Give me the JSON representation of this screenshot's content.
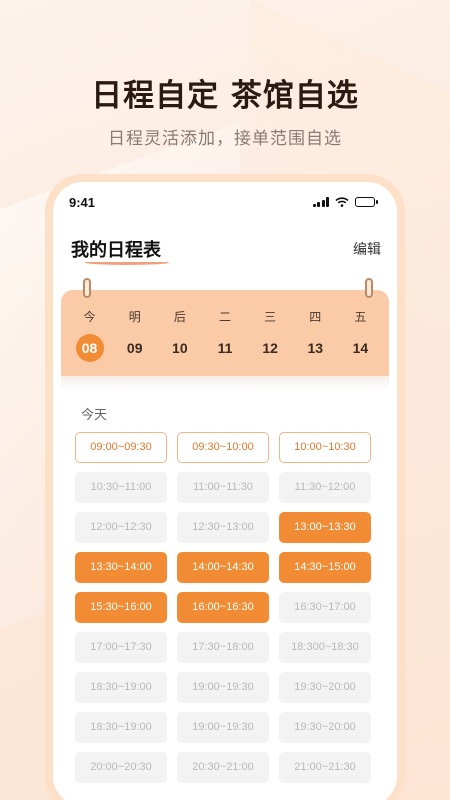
{
  "promo": {
    "headline": "日程自定  茶馆自选",
    "subline": "日程灵活添加，接单范围自选"
  },
  "status_bar": {
    "time": "9:41",
    "icons": [
      "signal-icon",
      "wifi-icon",
      "battery-icon"
    ]
  },
  "header": {
    "title": "我的日程表",
    "edit_label": "编辑"
  },
  "calendar": {
    "days": [
      {
        "weekday": "今",
        "date": "08",
        "active": true
      },
      {
        "weekday": "明",
        "date": "09",
        "active": false
      },
      {
        "weekday": "后",
        "date": "10",
        "active": false
      },
      {
        "weekday": "二",
        "date": "11",
        "active": false
      },
      {
        "weekday": "三",
        "date": "12",
        "active": false
      },
      {
        "weekday": "四",
        "date": "13",
        "active": false
      },
      {
        "weekday": "五",
        "date": "14",
        "active": false
      }
    ]
  },
  "today_label": "今天",
  "slots": [
    {
      "label": "09:00~09:30",
      "state": "outline"
    },
    {
      "label": "09:30~10:00",
      "state": "outline"
    },
    {
      "label": "10:00~10:30",
      "state": "outline"
    },
    {
      "label": "10:30~11:00",
      "state": "disabled"
    },
    {
      "label": "11:00~11:30",
      "state": "disabled"
    },
    {
      "label": "11:30~12:00",
      "state": "disabled"
    },
    {
      "label": "12:00~12:30",
      "state": "disabled"
    },
    {
      "label": "12:30~13:00",
      "state": "disabled"
    },
    {
      "label": "13:00~13:30",
      "state": "selected"
    },
    {
      "label": "13:30~14:00",
      "state": "selected"
    },
    {
      "label": "14:00~14:30",
      "state": "selected"
    },
    {
      "label": "14:30~15:00",
      "state": "selected"
    },
    {
      "label": "15:30~16:00",
      "state": "selected"
    },
    {
      "label": "16:00~16:30",
      "state": "selected"
    },
    {
      "label": "16:30~17:00",
      "state": "disabled"
    },
    {
      "label": "17:00~17:30",
      "state": "disabled"
    },
    {
      "label": "17:30~18:00",
      "state": "disabled"
    },
    {
      "label": "18:300~18:30",
      "state": "disabled"
    },
    {
      "label": "18:30~19:00",
      "state": "disabled"
    },
    {
      "label": "19:00~19:30",
      "state": "disabled"
    },
    {
      "label": "19:30~20:00",
      "state": "disabled"
    },
    {
      "label": "18:30~19:00",
      "state": "disabled"
    },
    {
      "label": "19:00~19:30",
      "state": "disabled"
    },
    {
      "label": "19:30~20:00",
      "state": "disabled"
    },
    {
      "label": "20:00~20:30",
      "state": "disabled"
    },
    {
      "label": "20:30~21:00",
      "state": "disabled"
    },
    {
      "label": "21:00~21:30",
      "state": "disabled"
    }
  ],
  "colors": {
    "accent": "#f28c34",
    "calendar_bg": "#fbcaa6",
    "phone_frame": "#fde0c8"
  }
}
